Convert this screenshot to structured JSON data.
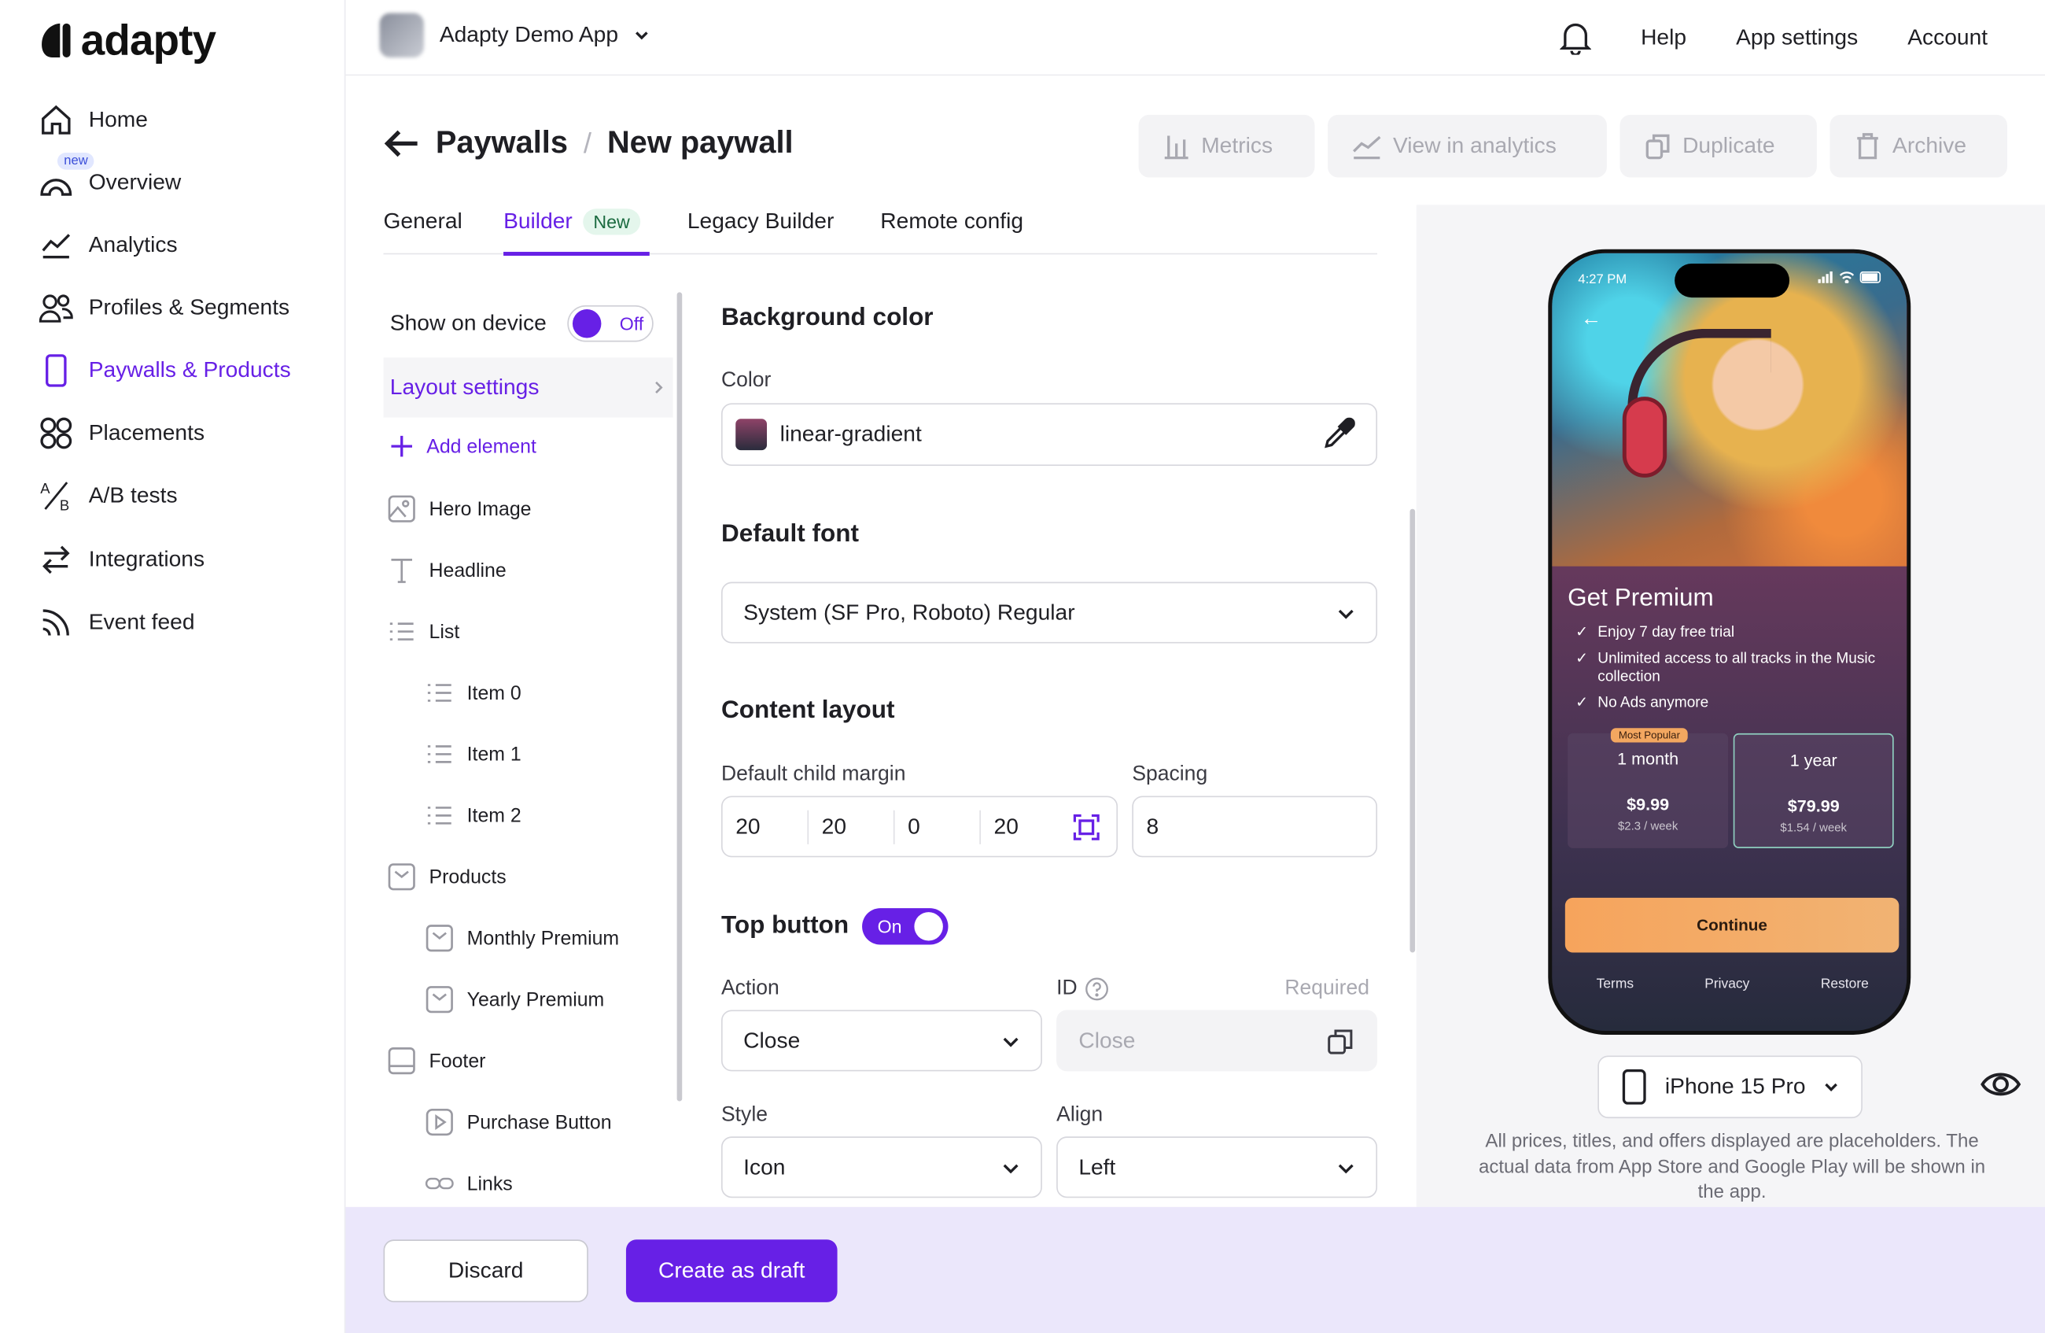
{
  "brand": {
    "logo_text": "adapty",
    "accent": "#6720e6"
  },
  "sidebar": {
    "items": [
      {
        "label": "Home",
        "icon": "home-icon"
      },
      {
        "label": "Overview",
        "icon": "gauge-icon",
        "badge": "new"
      },
      {
        "label": "Analytics",
        "icon": "chart-line-icon"
      },
      {
        "label": "Profiles & Segments",
        "icon": "users-icon"
      },
      {
        "label": "Paywalls & Products",
        "icon": "phone-icon",
        "active": true
      },
      {
        "label": "Placements",
        "icon": "grid-circles-icon"
      },
      {
        "label": "A/B tests",
        "icon": "ab-test-icon"
      },
      {
        "label": "Integrations",
        "icon": "arrows-swap-icon"
      },
      {
        "label": "Event feed",
        "icon": "feed-icon"
      }
    ]
  },
  "header": {
    "app_name": "Adapty Demo App",
    "links": [
      "Help",
      "App settings",
      "Account"
    ]
  },
  "page": {
    "breadcrumb_root": "Paywalls",
    "breadcrumb_sep": "/",
    "title": "New paywall",
    "actions": [
      "Metrics",
      "View in analytics",
      "Duplicate",
      "Archive"
    ]
  },
  "tabs": [
    {
      "label": "General"
    },
    {
      "label": "Builder",
      "badge": "New",
      "active": true
    },
    {
      "label": "Legacy Builder"
    },
    {
      "label": "Remote config"
    }
  ],
  "tree": {
    "show_on_device_label": "Show on device",
    "show_on_device_state": "Off",
    "layout_settings": "Layout settings",
    "add_element": "Add element",
    "items": [
      {
        "label": "Hero Image",
        "level": 0,
        "icon": "image-icon"
      },
      {
        "label": "Headline",
        "level": 0,
        "icon": "text-icon"
      },
      {
        "label": "List",
        "level": 0,
        "icon": "list-icon"
      },
      {
        "label": "Item 0",
        "level": 1,
        "icon": "list-icon"
      },
      {
        "label": "Item 1",
        "level": 1,
        "icon": "list-icon"
      },
      {
        "label": "Item 2",
        "level": 1,
        "icon": "list-icon"
      },
      {
        "label": "Products",
        "level": 0,
        "icon": "products-icon"
      },
      {
        "label": "Monthly Premium",
        "level": 1,
        "icon": "products-icon"
      },
      {
        "label": "Yearly Premium",
        "level": 1,
        "icon": "products-icon"
      },
      {
        "label": "Footer",
        "level": 0,
        "icon": "footer-icon"
      },
      {
        "label": "Purchase Button",
        "level": 1,
        "icon": "play-icon"
      },
      {
        "label": "Links",
        "level": 1,
        "icon": "link-icon"
      }
    ]
  },
  "settings": {
    "background": {
      "title": "Background color",
      "color_label": "Color",
      "color_value": "linear-gradient"
    },
    "font": {
      "title": "Default font",
      "value": "System (SF Pro, Roboto) Regular"
    },
    "content": {
      "title": "Content layout",
      "margin_label": "Default child margin",
      "margins": [
        "20",
        "20",
        "0",
        "20"
      ],
      "spacing_label": "Spacing",
      "spacing_value": "8"
    },
    "top_button": {
      "title": "Top button",
      "state": "On",
      "action_label": "Action",
      "action_value": "Close",
      "id_label": "ID",
      "id_required": "Required",
      "id_placeholder": "Close",
      "style_label": "Style",
      "style_value": "Icon",
      "align_label": "Align",
      "align_value": "Left"
    }
  },
  "preview": {
    "status_time": "4:27 PM",
    "heading": "Get Premium",
    "features": [
      "Enjoy 7 day free trial",
      "Unlimited access to all tracks in the Music collection",
      "No Ads anymore"
    ],
    "products": [
      {
        "badge": "Most Popular",
        "title": "1 month",
        "price": "$9.99",
        "per_week": "$2.3 / week"
      },
      {
        "title": "1 year",
        "price": "$79.99",
        "per_week": "$1.54 / week"
      }
    ],
    "cta": "Continue",
    "footer_links": [
      "Terms",
      "Privacy",
      "Restore"
    ],
    "device": "iPhone 15 Pro",
    "note": "All prices, titles, and offers displayed are placeholders. The actual data from App Store and Google Play will be shown in the app."
  },
  "footer": {
    "discard": "Discard",
    "create": "Create as draft"
  }
}
